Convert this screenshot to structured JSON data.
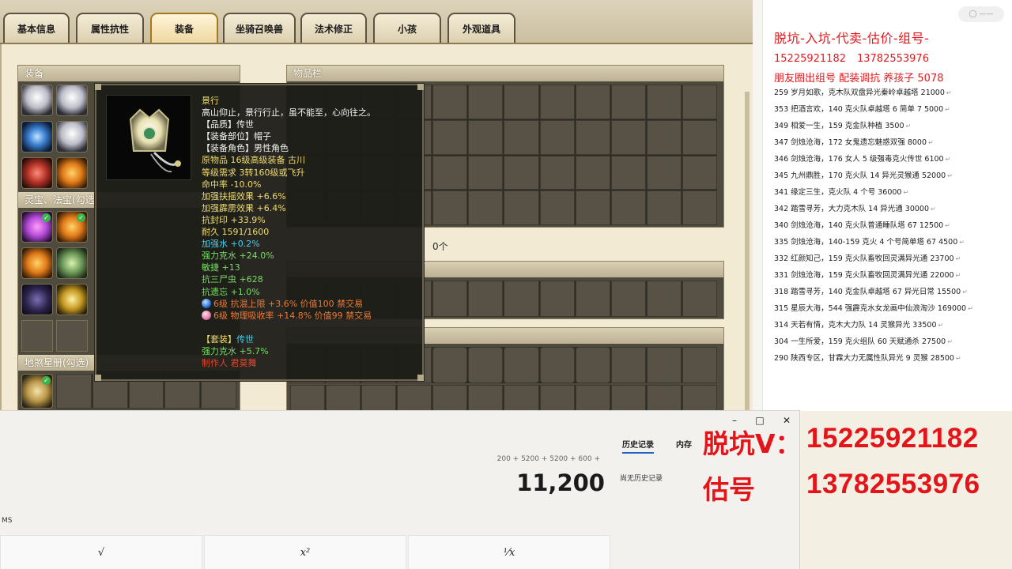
{
  "game": {
    "tabs": [
      "基本信息",
      "属性抗性",
      "装备",
      "坐骑召唤兽",
      "法术修正",
      "小孩",
      "外观道具"
    ],
    "active_tab": "装备",
    "panels": {
      "equipment": "装备",
      "inventory": "物品栏",
      "treasures": "灵宝、法宝(勾选",
      "star_book": "地煞星册(勾选)"
    },
    "inventory_count": "0个"
  },
  "tooltip": {
    "lines": [
      {
        "text": "景行",
        "color": "yel"
      },
      {
        "text": "高山仰止，景行行止，虽不能至，心向往之。",
        "color": "wht"
      },
      {
        "text": "【品质】传世",
        "color": "wht"
      },
      {
        "text": "【装备部位】帽子",
        "color": "wht"
      },
      {
        "text": "【装备角色】男性角色",
        "color": "wht"
      },
      {
        "text": "原物品 16级高级装备 古川",
        "color": "yel"
      },
      {
        "text": "等级需求 3转160级或飞升",
        "color": "yel"
      },
      {
        "text": "命中率 -10.0%",
        "color": "yel"
      },
      {
        "text": "加强扶摇效果 +6.6%",
        "color": "yel"
      },
      {
        "text": "加强霹雳效果 +6.4%",
        "color": "yel"
      },
      {
        "text": "抗封印 +33.9%",
        "color": "yel"
      },
      {
        "text": "耐久 1591/1600",
        "color": "yel"
      },
      {
        "text": "加强水 +0.2%",
        "color": "cyn"
      },
      {
        "text": "强力克水 +24.0%",
        "color": "grn"
      },
      {
        "text": "敏捷 +13",
        "color": "grn"
      },
      {
        "text": "抗三尸虫 +628",
        "color": "grn"
      },
      {
        "text": "抗遗忘 +1.0%",
        "color": "grn"
      },
      {
        "text": "6级 抗混上限 +3.6% 价值100 禁交易",
        "color": "org",
        "gem": "blue"
      },
      {
        "text": "6级 物理吸收率 +14.8% 价值99 禁交易",
        "color": "org",
        "gem": "pink"
      },
      {
        "text": "",
        "color": "wht"
      },
      {
        "text": "【套装】",
        "color": "yel",
        "suffix": "传世",
        "suffix_color": "cyn"
      },
      {
        "text": "强力克水 +5.7%",
        "color": "grn"
      },
      {
        "text": "制作人 君莫舞",
        "color": "red"
      }
    ]
  },
  "calculator": {
    "expression": "200 + 5200 + 5200 + 600 +",
    "result": "11,200",
    "ms_label": "MS",
    "history_tab": "历史记录",
    "memory_tab": "内存",
    "no_history": "尚无历史记录",
    "keys": [
      "√",
      "x²",
      "¹⁄x"
    ],
    "window_buttons": {
      "min": "–",
      "max": "□",
      "close": "✕"
    }
  },
  "overlay": {
    "label1": "脱坑V：",
    "number1": "15225921182",
    "label2": "估号",
    "number2": "13782553976"
  },
  "doc": {
    "badge": "◯ ——",
    "header1": "脱坑-入坑-代卖-估价-组号-",
    "phone1": "15225921182",
    "phone2": "13782553976",
    "header3": "朋友圈出组号   配装调抗  养孩子 5078",
    "rows": [
      "259 岁月如歌，克木队双盘异光秦岭卓越塔 21000",
      "353 把酒言欢，140 克火队卓越塔 6 简单 7  5000",
      "349 相爱一生，159 克金队种植 3500",
      "347 剑烛沧海，172 女鬼遗忘魅惑双强 8000",
      "346 剑烛沧海，176 女人 5 级强毒克火传世 6100",
      "345 九州鼎胜，170 克火队 14 异光灵猴通 52000",
      "341 缘定三生，克火队 4 个号 36000",
      "342 踏雪寻芳，大力克木队 14 异光通 30000",
      "340 剑烛沧海，140 克火队普通睡队塔 67  12500",
      "335 剑烛沧海，140-159 克火 4 个号简单塔 67  4500",
      "332 红颜知己，159 克火队畜牧回灵满异光通 23700",
      "331 剑烛沧海，159 克火队畜牧回灵满异光通 22000",
      "318 踏雪寻芳，140 克金队卓越塔 67 异光日常 15500",
      "315 星辰大海，544 强霹克水女龙画中仙浪淘沙 169000",
      "314 天若有情，克木大力队 14 灵猴异光 33500",
      "304 一生所爱，159 克火组队 60 天赋通杀 27500",
      "290 陕西专区，甘霖大力无属性队异光 9 灵猴 28500"
    ],
    "row_mark": "↵"
  },
  "colors": {
    "accent_red": "#e0191d",
    "tab_active_border": "#a8761c",
    "tooltip_bg": "#1c1c18"
  }
}
